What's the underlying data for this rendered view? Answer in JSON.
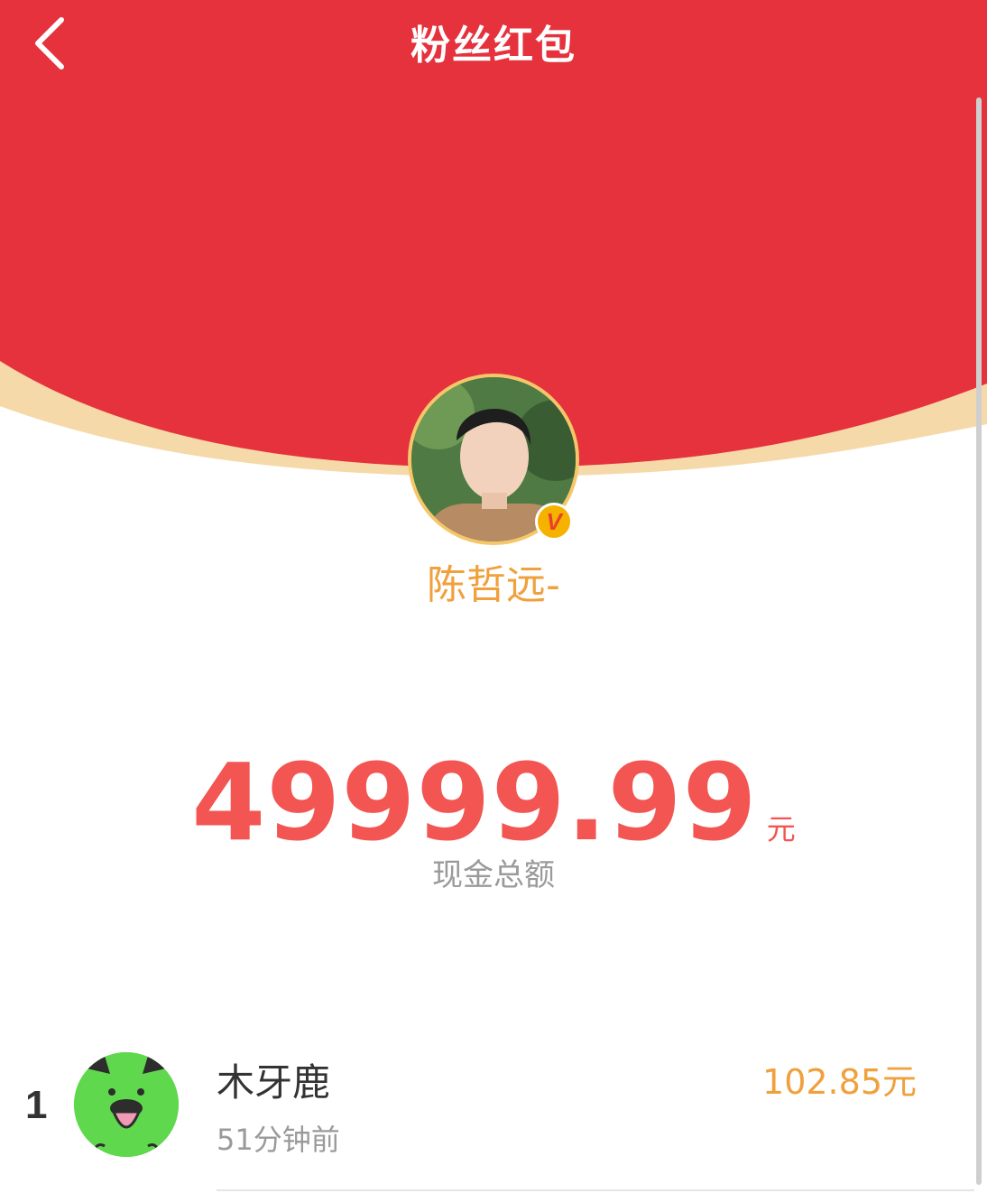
{
  "nav": {
    "title": "粉丝红包",
    "back_icon": "chevron-left-icon"
  },
  "colors": {
    "header_red": "#e5323d",
    "accent_orange": "#f0a03c",
    "amount_red": "#f25552",
    "gold_rim": "#f6d9a8"
  },
  "host": {
    "name": "陈哲远-",
    "verified_badge_icon": "v-verified-icon"
  },
  "red_packet": {
    "amount": "49999.99",
    "currency": "元",
    "label": "现金总额"
  },
  "recipients": [
    {
      "rank": "1",
      "name": "木牙鹿",
      "time": "51分钟前",
      "amount": "102.85元"
    }
  ]
}
